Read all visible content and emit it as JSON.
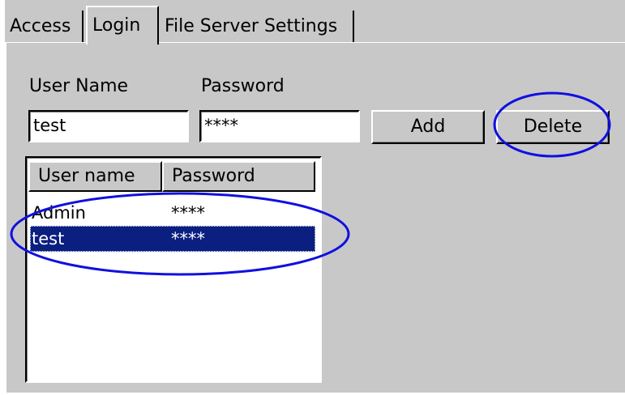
{
  "tabs": [
    {
      "label": "Access",
      "active": false
    },
    {
      "label": "Login",
      "active": true
    },
    {
      "label": "File Server Settings",
      "active": false
    }
  ],
  "form": {
    "user_name_label": "User Name",
    "password_label": "Password",
    "user_name_value": "test",
    "password_value": "****",
    "add_label": "Add",
    "delete_label": "Delete"
  },
  "list": {
    "columns": [
      "User name",
      "Password"
    ],
    "rows": [
      {
        "user": "Admin",
        "password": "****",
        "selected": false
      },
      {
        "user": "test",
        "password": "****",
        "selected": true
      }
    ]
  },
  "colors": {
    "panel_bg": "#c8c8c8",
    "selection": "#0a1f80",
    "annotation": "#1010e0"
  }
}
